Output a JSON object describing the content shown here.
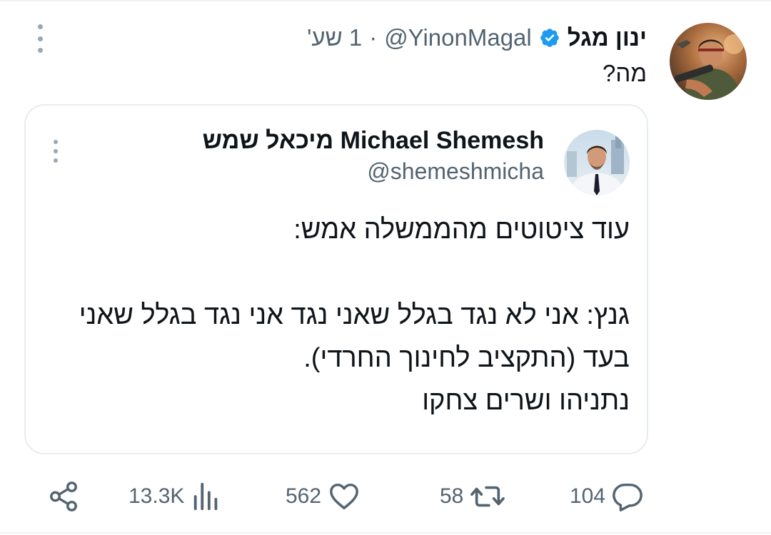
{
  "tweet": {
    "author_name": "ינון מגל",
    "handle": "@YinonMagal",
    "separator": "·",
    "time": "1 שע'",
    "text": "מה?",
    "verified_icon": "verified-badge-icon",
    "more_icon": "more-options-icon"
  },
  "quote": {
    "author_name": "מיכאל שמש Michael Shemesh",
    "handle": "@shemeshmicha",
    "lines": [
      "עוד ציטוטים מהממשלה אמש:",
      "",
      "גנץ: אני לא נגד בגלל שאני נגד אני נגד בגלל שאני",
      "בעד (התקציב לחינוך החרדי).",
      "נתניהו ושרים צחקו"
    ]
  },
  "actions": {
    "replies": "104",
    "retweets": "58",
    "likes": "562",
    "views": "13.3K",
    "reply_icon": "reply-icon",
    "retweet_icon": "retweet-icon",
    "like_icon": "heart-icon",
    "views_icon": "views-chart-icon",
    "share_icon": "share-icon"
  },
  "colors": {
    "text_primary": "#0f1419",
    "text_secondary": "#536471",
    "verified_blue": "#1d9bf0",
    "border": "#e6ecf0"
  }
}
